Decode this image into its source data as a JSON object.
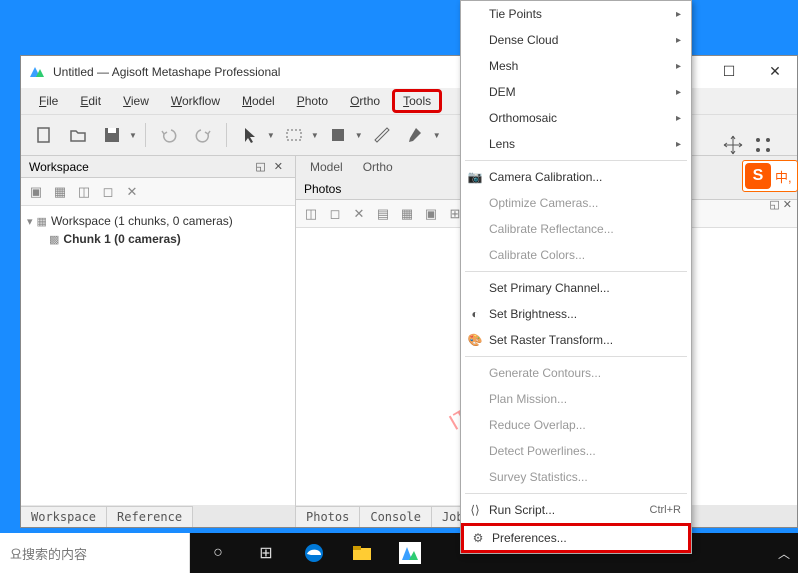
{
  "window": {
    "title": "Untitled — Agisoft Metashape Professional"
  },
  "menubar": {
    "file": "File",
    "edit": "Edit",
    "view": "View",
    "workflow": "Workflow",
    "model": "Model",
    "photo": "Photo",
    "ortho": "Ortho",
    "tools": "Tools"
  },
  "workspace_panel": {
    "title": "Workspace",
    "root": "Workspace (1 chunks, 0 cameras)",
    "chunk": "Chunk 1 (0 cameras)",
    "tab_workspace": "Workspace",
    "tab_reference": "Reference"
  },
  "view_tabs": {
    "model": "Model",
    "ortho": "Ortho"
  },
  "photos_panel": {
    "title": "Photos",
    "tab_photos": "Photos",
    "tab_console": "Console",
    "tab_jobs": "Jobs"
  },
  "tools_menu": {
    "tie_points": "Tie Points",
    "dense_cloud": "Dense Cloud",
    "mesh": "Mesh",
    "dem": "DEM",
    "orthomosaic": "Orthomosaic",
    "lens": "Lens",
    "camera_calibration": "Camera Calibration...",
    "optimize_cameras": "Optimize Cameras...",
    "calibrate_reflectance": "Calibrate Reflectance...",
    "calibrate_colors": "Calibrate Colors...",
    "set_primary_channel": "Set Primary Channel...",
    "set_brightness": "Set Brightness...",
    "set_raster_transform": "Set Raster Transform...",
    "generate_contours": "Generate Contours...",
    "plan_mission": "Plan Mission...",
    "reduce_overlap": "Reduce Overlap...",
    "detect_powerlines": "Detect Powerlines...",
    "survey_statistics": "Survey Statistics...",
    "run_script": "Run Script...",
    "run_script_shortcut": "Ctrl+R",
    "preferences": "Preferences..."
  },
  "watermark": "IT技术之家www.ittel.cn",
  "taskbar": {
    "search_placeholder": "요搜索的内容"
  },
  "sogou": {
    "letter": "S",
    "text": "中,"
  }
}
